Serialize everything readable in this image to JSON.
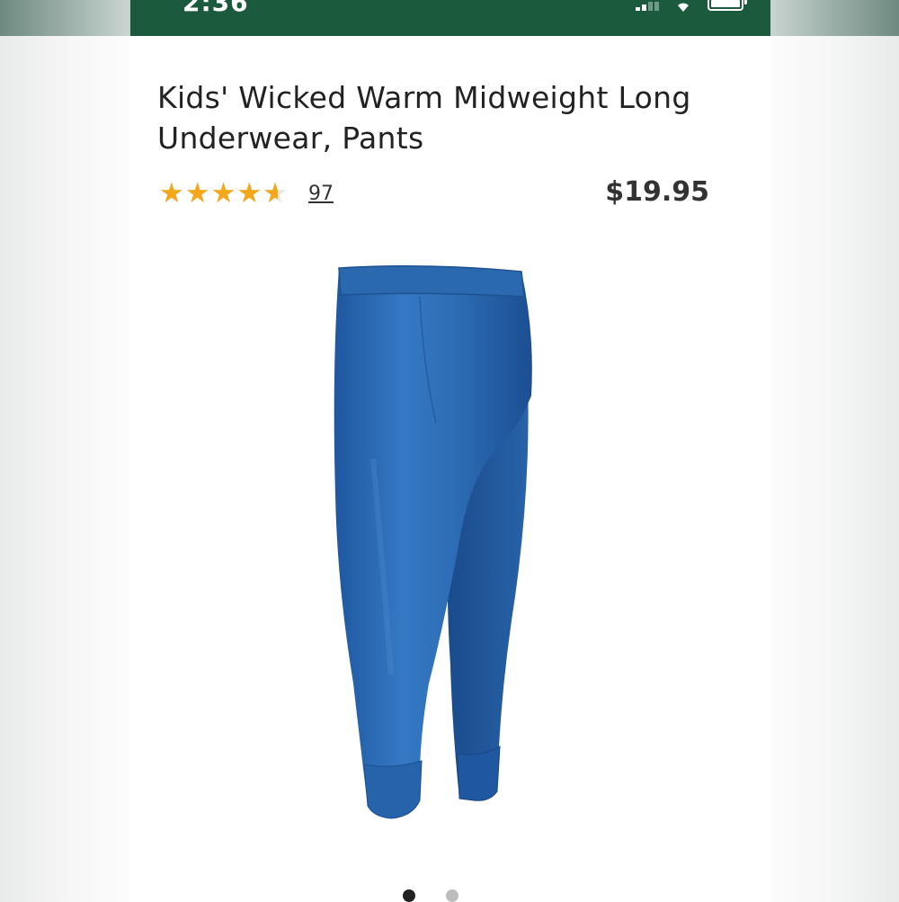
{
  "status_bar": {
    "time": "2:36",
    "background_color": "#1b5a3d",
    "icons": [
      "cellular-signal-icon",
      "wifi-icon",
      "battery-icon"
    ]
  },
  "product": {
    "title": "Kids' Wicked Warm Midweight Long Underwear, Pants",
    "rating": {
      "value": 4.6,
      "max": 5,
      "star_glyphs": "★★★★★",
      "review_count": "97",
      "star_color": "#f3a81b"
    },
    "price": "$19.95",
    "image": {
      "subject": "product-photo-blue-long-underwear-pants",
      "color": "#2e6fb8"
    }
  },
  "carousel": {
    "active_index": 0,
    "total": 2
  }
}
